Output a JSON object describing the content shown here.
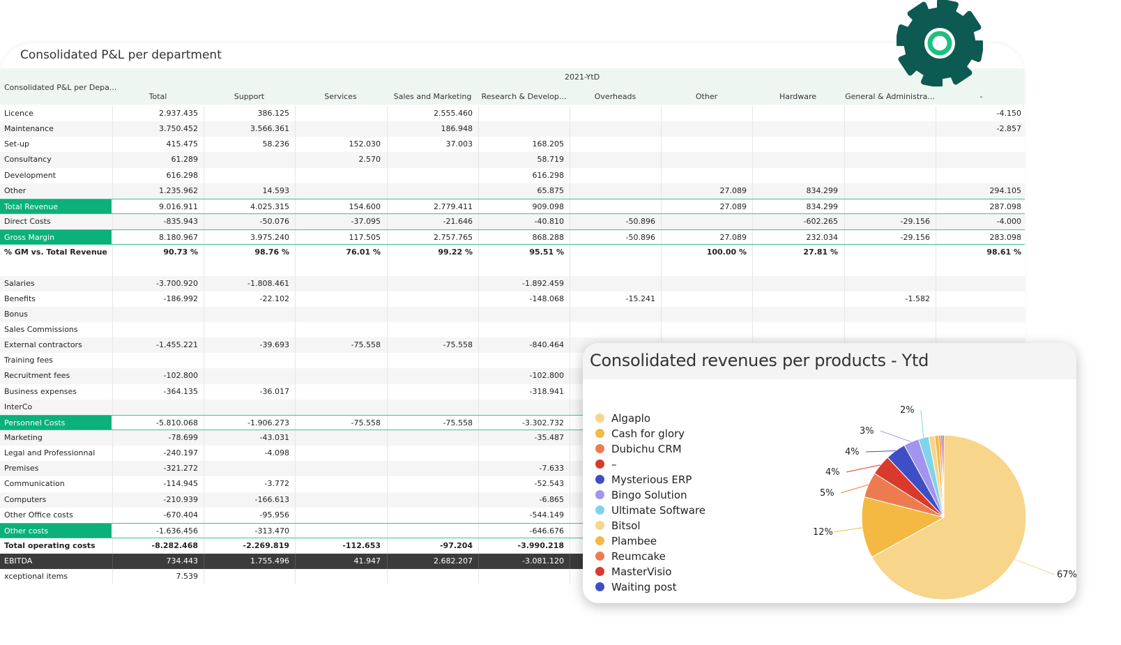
{
  "table": {
    "title": "Consolidated P&L per department",
    "corner_label": "Consolidated P&L per Depa...",
    "group_label": "2021-YtD",
    "columns": [
      "Total",
      "Support",
      "Services",
      "Sales and Marketing",
      "Research & Develop...",
      "Overheads",
      "Other",
      "Hardware",
      "General & Administra...",
      "-"
    ],
    "rows": [
      {
        "label": "Licence",
        "style": "",
        "values": [
          "2.937.435",
          "386.125",
          "",
          "2.555.460",
          "",
          "",
          "",
          "",
          "",
          "-4.150"
        ]
      },
      {
        "label": "Maintenance",
        "style": "",
        "values": [
          "3.750.452",
          "3.566.361",
          "",
          "186.948",
          "",
          "",
          "",
          "",
          "",
          "-2.857"
        ]
      },
      {
        "label": "Set-up",
        "style": "",
        "values": [
          "415.475",
          "58.236",
          "152.030",
          "37.003",
          "168.205",
          "",
          "",
          "",
          "",
          ""
        ]
      },
      {
        "label": "Consultancy",
        "style": "",
        "values": [
          "61.289",
          "",
          "2.570",
          "",
          "58.719",
          "",
          "",
          "",
          "",
          ""
        ]
      },
      {
        "label": "Development",
        "style": "",
        "values": [
          "616.298",
          "",
          "",
          "",
          "616.298",
          "",
          "",
          "",
          "",
          ""
        ]
      },
      {
        "label": "Other",
        "style": "",
        "values": [
          "1.235.962",
          "14.593",
          "",
          "",
          "65.875",
          "",
          "27.089",
          "834.299",
          "",
          "294.105"
        ]
      },
      {
        "label": "Total Revenue",
        "style": "hl",
        "values": [
          "9.016.911",
          "4.025.315",
          "154.600",
          "2.779.411",
          "909.098",
          "",
          "27.089",
          "834.299",
          "",
          "287.098"
        ]
      },
      {
        "label": "Direct Costs",
        "style": "",
        "values": [
          "-835.943",
          "-50.076",
          "-37.095",
          "-21.646",
          "-40.810",
          "-50.896",
          "",
          "-602.265",
          "-29.156",
          "-4.000"
        ]
      },
      {
        "label": "Gross Margin",
        "style": "hl",
        "values": [
          "8.180.967",
          "3.975.240",
          "117.505",
          "2.757.765",
          "868.288",
          "-50.896",
          "27.089",
          "232.034",
          "-29.156",
          "283.098"
        ]
      },
      {
        "label": "% GM vs. Total Revenue",
        "style": "bold",
        "values": [
          "90.73 %",
          "98.76 %",
          "76.01 %",
          "99.22 %",
          "95.51 %",
          "",
          "100.00 %",
          "27.81 %",
          "",
          "98.61 %"
        ]
      },
      {
        "label": "",
        "style": "",
        "values": [
          "",
          "",
          "",
          "",
          "",
          "",
          "",
          "",
          "",
          ""
        ]
      },
      {
        "label": "Salaries",
        "style": "",
        "values": [
          "-3.700.920",
          "-1.808.461",
          "",
          "",
          "-1.892.459",
          "",
          "",
          "",
          "",
          ""
        ]
      },
      {
        "label": "Benefits",
        "style": "",
        "values": [
          "-186.992",
          "-22.102",
          "",
          "",
          "-148.068",
          "-15.241",
          "",
          "",
          "-1.582",
          ""
        ]
      },
      {
        "label": "Bonus",
        "style": "",
        "values": [
          "",
          "",
          "",
          "",
          "",
          "",
          "",
          "",
          "",
          ""
        ]
      },
      {
        "label": "Sales Commissions",
        "style": "",
        "values": [
          "",
          "",
          "",
          "",
          "",
          "",
          "",
          "",
          "",
          ""
        ]
      },
      {
        "label": "External contractors",
        "style": "",
        "values": [
          "-1.455.221",
          "-39.693",
          "-75.558",
          "-75.558",
          "-840.464",
          "",
          "",
          "",
          "",
          ""
        ]
      },
      {
        "label": "Training fees",
        "style": "",
        "values": [
          "",
          "",
          "",
          "",
          "",
          "",
          "",
          "",
          "",
          ""
        ]
      },
      {
        "label": "Recruitment fees",
        "style": "",
        "values": [
          "-102.800",
          "",
          "",
          "",
          "-102.800",
          "",
          "",
          "",
          "",
          ""
        ]
      },
      {
        "label": "Business expenses",
        "style": "",
        "values": [
          "-364.135",
          "-36.017",
          "",
          "",
          "-318.941",
          "",
          "",
          "",
          "",
          ""
        ]
      },
      {
        "label": "InterCo",
        "style": "",
        "values": [
          "",
          "",
          "",
          "",
          "",
          "",
          "",
          "",
          "",
          ""
        ]
      },
      {
        "label": "Personnel Costs",
        "style": "hl",
        "values": [
          "-5.810.068",
          "-1.906.273",
          "-75.558",
          "-75.558",
          "-3.302.732",
          "",
          "",
          "",
          "",
          ""
        ]
      },
      {
        "label": "Marketing",
        "style": "",
        "values": [
          "-78.699",
          "-43.031",
          "",
          "",
          "-35.487",
          "",
          "",
          "",
          "",
          ""
        ]
      },
      {
        "label": "Legal and Professionnal",
        "style": "",
        "values": [
          "-240.197",
          "-4.098",
          "",
          "",
          "",
          "",
          "",
          "",
          "",
          ""
        ]
      },
      {
        "label": "Premises",
        "style": "",
        "values": [
          "-321.272",
          "",
          "",
          "",
          "-7.633",
          "",
          "",
          "",
          "",
          ""
        ]
      },
      {
        "label": "Communication",
        "style": "",
        "values": [
          "-114.945",
          "-3.772",
          "",
          "",
          "-52.543",
          "",
          "",
          "",
          "",
          ""
        ]
      },
      {
        "label": "Computers",
        "style": "",
        "values": [
          "-210.939",
          "-166.613",
          "",
          "",
          "-6.865",
          "",
          "",
          "",
          "",
          ""
        ]
      },
      {
        "label": "Other Office costs",
        "style": "",
        "values": [
          "-670.404",
          "-95.956",
          "",
          "",
          "-544.149",
          "",
          "",
          "",
          "",
          ""
        ]
      },
      {
        "label": "Other costs",
        "style": "hl",
        "values": [
          "-1.636.456",
          "-313.470",
          "",
          "",
          "-646.676",
          "",
          "",
          "",
          "",
          ""
        ]
      },
      {
        "label": "Total operating costs",
        "style": "bold",
        "values": [
          "-8.282.468",
          "-2.269.819",
          "-112.653",
          "-97.204",
          "-3.990.218",
          "",
          "",
          "",
          "",
          ""
        ]
      },
      {
        "label": "EBITDA",
        "style": "dark",
        "values": [
          "734.443",
          "1.755.496",
          "41.947",
          "2.682.207",
          "-3.081.120",
          "",
          "",
          "",
          "",
          ""
        ]
      },
      {
        "label": "xceptional items",
        "style": "",
        "values": [
          "7.539",
          "",
          "",
          "",
          "",
          "",
          "",
          "",
          "",
          ""
        ]
      }
    ]
  },
  "gear": {
    "icon": "gear-icon",
    "color": "#0d5a52",
    "ring_color": "#1fbf7e"
  },
  "chart": {
    "title": "Consolidated revenues per products - Ytd",
    "chart_data": {
      "type": "pie",
      "title": "Consolidated revenues per products - Ytd",
      "legend_position": "left",
      "slices": [
        {
          "name": "Algaplo",
          "value": 67,
          "label": "67%",
          "color": "#f7d58a"
        },
        {
          "name": "Cash for glory",
          "value": 12,
          "label": "12%",
          "color": "#f4b942"
        },
        {
          "name": "Dubichu CRM",
          "value": 5,
          "label": "5%",
          "color": "#ec7c50"
        },
        {
          "name": "–",
          "value": 4,
          "label": "4%",
          "color": "#d93a2b"
        },
        {
          "name": "Mysterious ERP",
          "value": 4,
          "label": "4%",
          "color": "#3e4fc6"
        },
        {
          "name": "Bingo Solution",
          "value": 3,
          "label": "3%",
          "color": "#a394ef"
        },
        {
          "name": "Ultimate Software",
          "value": 2,
          "label": "2%",
          "color": "#80d3ec"
        },
        {
          "name": "Bitsol",
          "value": 1.2,
          "label": "",
          "color": "#f7d58a"
        },
        {
          "name": "Plambee",
          "value": 0.8,
          "label": "",
          "color": "#f4b942"
        },
        {
          "name": "Reumcake",
          "value": 0.4,
          "label": "",
          "color": "#ec7c50"
        },
        {
          "name": "MasterVisio",
          "value": 0.3,
          "label": "",
          "color": "#d93a2b"
        },
        {
          "name": "Waiting post",
          "value": 0.3,
          "label": "",
          "color": "#3e4fc6"
        }
      ]
    }
  }
}
